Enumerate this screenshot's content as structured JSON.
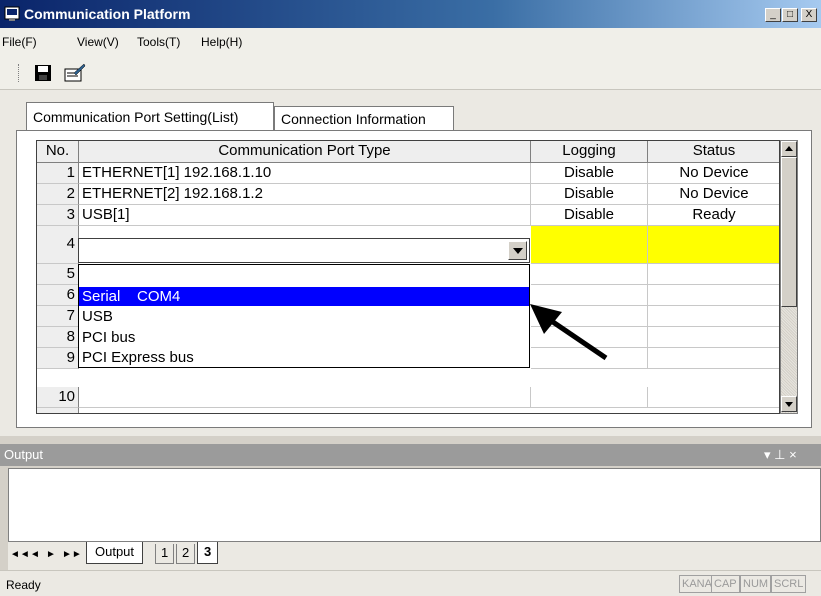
{
  "window": {
    "title": "Communication Platform"
  },
  "caption_buttons": {
    "minimize": "_",
    "maximize": "□",
    "close": "X"
  },
  "menu": [
    "File(F)",
    "View(V)",
    "Tools(T)",
    "Help(H)"
  ],
  "toolbar": {
    "icons": [
      "save-icon",
      "edit-icon"
    ]
  },
  "tabs": [
    {
      "label": "Communication Port Setting(List)",
      "active": true
    },
    {
      "label": "Connection Information",
      "active": false
    }
  ],
  "grid": {
    "columns": [
      "No.",
      "Communication Port Type",
      "Logging",
      "Status"
    ],
    "rows": [
      {
        "no": "1",
        "type": "ETHERNET[1] 192.168.1.10",
        "logging": "Disable",
        "status": "No Device"
      },
      {
        "no": "2",
        "type": "ETHERNET[2] 192.168.1.2",
        "logging": "Disable",
        "status": "No Device"
      },
      {
        "no": "3",
        "type": "USB[1]",
        "logging": "Disable",
        "status": "Ready"
      },
      {
        "no": "4",
        "type": "",
        "logging": "",
        "status": ""
      },
      {
        "no": "5",
        "type": "",
        "logging": "",
        "status": ""
      },
      {
        "no": "6",
        "type": "",
        "logging": "",
        "status": ""
      },
      {
        "no": "7",
        "type": "",
        "logging": "",
        "status": ""
      },
      {
        "no": "8",
        "type": "",
        "logging": "",
        "status": ""
      },
      {
        "no": "9",
        "type": "",
        "logging": "",
        "status": ""
      },
      {
        "no": "10",
        "type": "",
        "logging": "",
        "status": ""
      }
    ]
  },
  "dropdown": {
    "options": [
      "",
      "Serial    COM4",
      "USB",
      "PCI bus",
      "PCI Express bus"
    ],
    "selected_index": 1
  },
  "output": {
    "title": "Output",
    "pin_glyph": "▾ ⊥ ×",
    "nav": [
      "◄◄",
      "◄",
      "►",
      "►►"
    ],
    "tabs": [
      "Output",
      "1",
      "2",
      "3"
    ]
  },
  "status": {
    "text": "Ready",
    "indicators": [
      "KANA",
      "CAP",
      "NUM",
      "SCRL"
    ]
  },
  "colors": {
    "selection": "#0000ff",
    "new_row": "#ffff00",
    "titlebar": "#0a246a"
  }
}
